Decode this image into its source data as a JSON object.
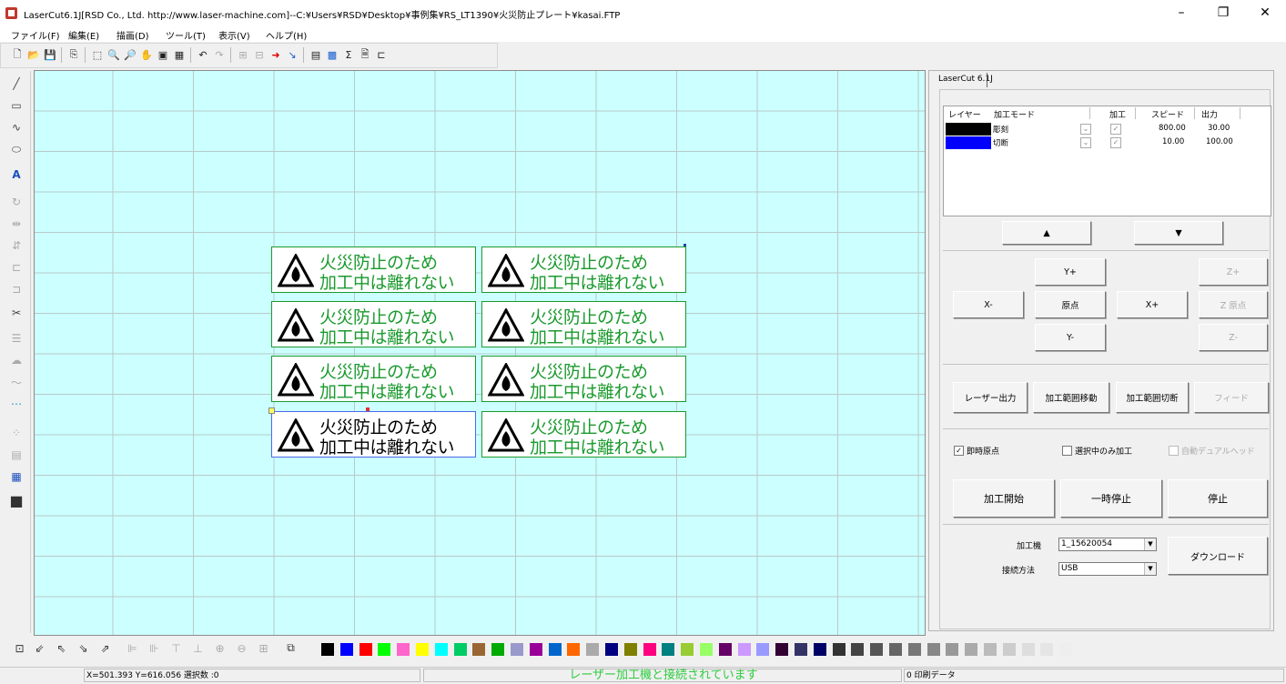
{
  "window": {
    "title": "LaserCut6.1J[RSD Co., Ltd. http://www.laser-machine.com]--C:¥Users¥RSD¥Desktop¥事例集¥RS_LT1390¥火災防止プレート¥kasai.FTP",
    "controls": [
      "–",
      "❐",
      "✕"
    ]
  },
  "menu": [
    "ファイル(F)",
    "編集(E)",
    "描画(D)",
    "ツール(T)",
    "表示(V)",
    "ヘルプ(H)"
  ],
  "plate_text": {
    "line1": "火災防止のため",
    "line2": "加工中は離れない"
  },
  "panel": {
    "tab_label": "LaserCut 6.1J",
    "layer_headers": [
      "レイヤー",
      "加工モード",
      "加工",
      "スピード",
      "出力"
    ],
    "layers": [
      {
        "color": "#000000",
        "mode": "彫刻",
        "speed": "800.00",
        "power": "30.00"
      },
      {
        "color": "#0000ff",
        "mode": "切断",
        "speed": "10.00",
        "power": "100.00"
      }
    ],
    "up_arrow": "▲",
    "down_arrow": "▼",
    "yplus": "Y+",
    "yminus": "Y-",
    "xminus": "X-",
    "xplus": "X+",
    "origin": "原点",
    "zplus": "Z+",
    "zorigin": "Z 原点",
    "zminus": "Z-",
    "laser_output": "レーザー出力",
    "range_move": "加工範囲移動",
    "range_cut": "加工範囲切断",
    "feed": "フィード",
    "chk_origin": "即時原点",
    "chk_selected": "選択中のみ加工",
    "chk_dual": "自動デュアルヘッド",
    "start": "加工開始",
    "pause": "一時停止",
    "stop": "停止",
    "machine_label": "加工機",
    "machine_value": "1_15620054",
    "conn_label": "接続方法",
    "conn_value": "USB",
    "download": "ダウンロード"
  },
  "status": {
    "coords": "X=501.393 Y=616.056 選択数 :0",
    "message": "レーザー加工機と接続されています",
    "message_color": "#2ecc40",
    "print_data": "0 印刷データ"
  },
  "palette": [
    "#000000",
    "#0000ff",
    "#ff0000",
    "#00ff00",
    "#ff66cc",
    "#ffff00",
    "#00ffff",
    "#00cc66",
    "#996633",
    "#00aa00",
    "#9999cc",
    "#990099",
    "#0066cc",
    "#ff6600",
    "#aaaaaa",
    "#000080",
    "#808000",
    "#ff0080",
    "#008080",
    "#99cc33",
    "#99ff66",
    "#660066",
    "#cc99ff",
    "#9999ff",
    "#330033",
    "#333366",
    "#000066",
    "#333333",
    "#444444",
    "#555555",
    "#666666",
    "#777777",
    "#888888",
    "#999999",
    "#aaaaaa",
    "#bbbbbb",
    "#cccccc",
    "#dddddd",
    "#e5e5e5",
    "#eeeeee"
  ]
}
